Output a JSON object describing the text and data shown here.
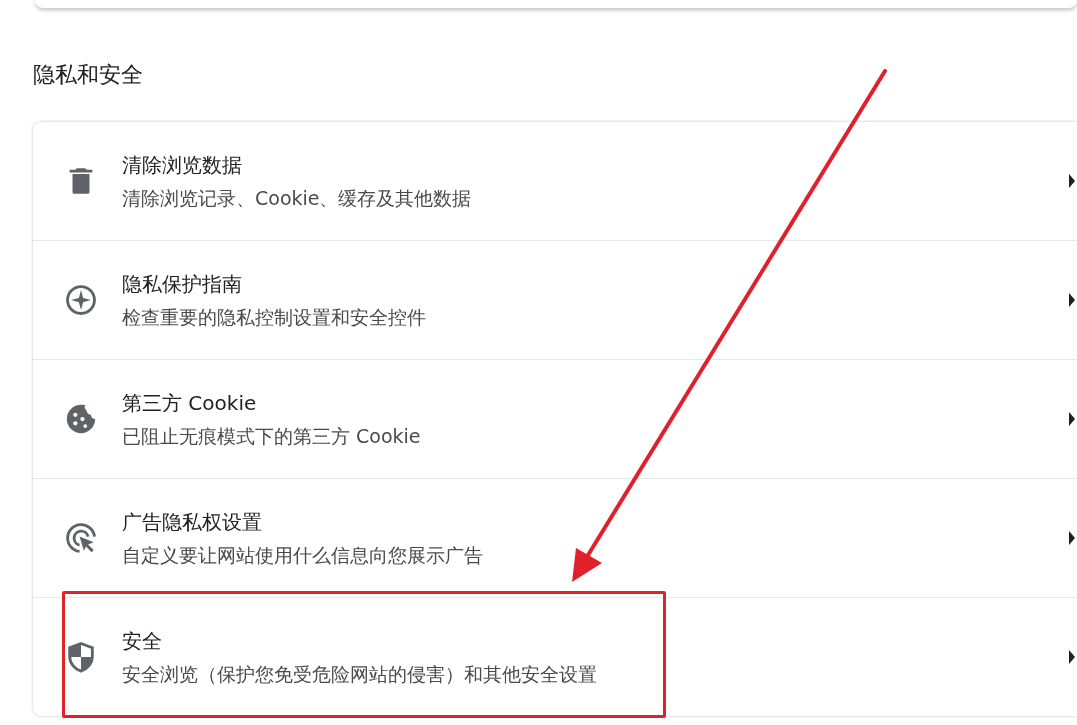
{
  "section_title": "隐私和安全",
  "items": [
    {
      "kind": "trash",
      "title": "清除浏览数据",
      "subtitle": "清除浏览记录、Cookie、缓存及其他数据",
      "highlighted": false
    },
    {
      "kind": "compass",
      "title": "隐私保护指南",
      "subtitle": "检查重要的隐私控制设置和安全控件",
      "highlighted": false
    },
    {
      "kind": "cookie",
      "title": "第三方 Cookie",
      "subtitle": "已阻止无痕模式下的第三方 Cookie",
      "highlighted": false
    },
    {
      "kind": "ads",
      "title": "广告隐私权设置",
      "subtitle": "自定义要让网站使用什么信息向您展示广告",
      "highlighted": false
    },
    {
      "kind": "shield",
      "title": "安全",
      "subtitle": "安全浏览（保护您免受危险网站的侵害）和其他安全设置",
      "highlighted": true
    }
  ]
}
